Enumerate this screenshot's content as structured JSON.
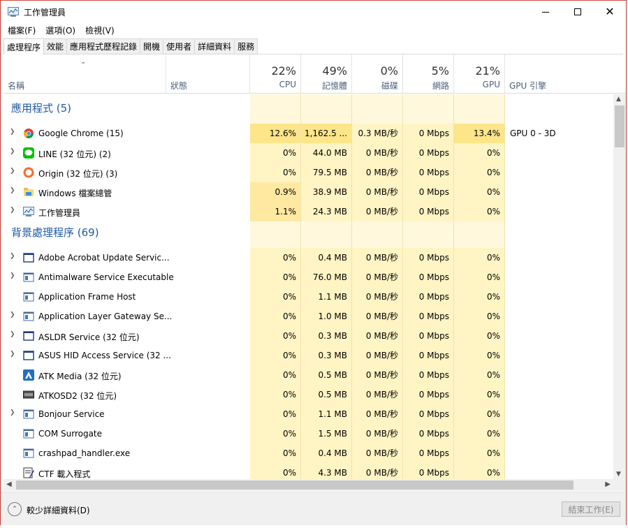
{
  "window": {
    "title": "工作管理員"
  },
  "menu": [
    "檔案(F)",
    "選項(O)",
    "檢視(V)"
  ],
  "tabs": [
    "處理程序",
    "效能",
    "應用程式歷程記錄",
    "開機",
    "使用者",
    "詳細資料",
    "服務"
  ],
  "header": {
    "name": "名稱",
    "status": "狀態",
    "cpu": {
      "pct": "22%",
      "label": "CPU"
    },
    "memory": {
      "pct": "49%",
      "label": "記憶體"
    },
    "disk": {
      "pct": "0%",
      "label": "磁碟"
    },
    "network": {
      "pct": "5%",
      "label": "網路"
    },
    "gpu": {
      "pct": "21%",
      "label": "GPU"
    },
    "gpu_engine": "GPU 引擎"
  },
  "groups": [
    {
      "title": "應用程式 (5)",
      "rows": [
        {
          "name": "Google Chrome (15)",
          "icon": "chrome-icon",
          "expand": true,
          "cpu": "12.6%",
          "mem": "1,162.5 ...",
          "disk": "0.3 MB/秒",
          "net": "0 Mbps",
          "gpu": "13.4%",
          "engine": "GPU 0 - 3D",
          "heat": [
            2,
            2,
            1,
            1,
            2
          ]
        },
        {
          "name": "LINE (32 位元) (2)",
          "icon": "line-icon",
          "expand": true,
          "cpu": "0%",
          "mem": "44.0 MB",
          "disk": "0 MB/秒",
          "net": "0 Mbps",
          "gpu": "0%",
          "engine": "",
          "heat": [
            1,
            1,
            1,
            1,
            1
          ]
        },
        {
          "name": "Origin (32 位元) (3)",
          "icon": "origin-icon",
          "expand": true,
          "cpu": "0%",
          "mem": "79.5 MB",
          "disk": "0 MB/秒",
          "net": "0 Mbps",
          "gpu": "0%",
          "engine": "",
          "heat": [
            1,
            1,
            1,
            1,
            1
          ]
        },
        {
          "name": "Windows 檔案總管",
          "icon": "folder-icon",
          "expand": true,
          "cpu": "0.9%",
          "mem": "38.9 MB",
          "disk": "0 MB/秒",
          "net": "0 Mbps",
          "gpu": "0%",
          "engine": "",
          "heat": [
            1.5,
            1,
            1,
            1,
            1
          ]
        },
        {
          "name": "工作管理員",
          "icon": "task-manager-icon",
          "expand": true,
          "cpu": "1.1%",
          "mem": "24.3 MB",
          "disk": "0 MB/秒",
          "net": "0 Mbps",
          "gpu": "0%",
          "engine": "",
          "heat": [
            1.5,
            1,
            1,
            1,
            1
          ]
        }
      ]
    },
    {
      "title": "背景處理程序 (69)",
      "rows": [
        {
          "name": "Adobe Acrobat Update Servic...",
          "icon": "window-icon",
          "expand": true,
          "cpu": "0%",
          "mem": "0.4 MB",
          "disk": "0 MB/秒",
          "net": "0 Mbps",
          "gpu": "0%",
          "engine": "",
          "heat": [
            1,
            1,
            1,
            1,
            1
          ]
        },
        {
          "name": "Antimalware Service Executable",
          "icon": "service-icon",
          "expand": true,
          "cpu": "0%",
          "mem": "76.0 MB",
          "disk": "0 MB/秒",
          "net": "0 Mbps",
          "gpu": "0%",
          "engine": "",
          "heat": [
            1,
            1,
            1,
            1,
            1
          ]
        },
        {
          "name": "Application Frame Host",
          "icon": "service-icon",
          "expand": false,
          "cpu": "0%",
          "mem": "1.1 MB",
          "disk": "0 MB/秒",
          "net": "0 Mbps",
          "gpu": "0%",
          "engine": "",
          "heat": [
            1,
            1,
            1,
            1,
            1
          ]
        },
        {
          "name": "Application Layer Gateway Se...",
          "icon": "service-icon",
          "expand": true,
          "cpu": "0%",
          "mem": "1.0 MB",
          "disk": "0 MB/秒",
          "net": "0 Mbps",
          "gpu": "0%",
          "engine": "",
          "heat": [
            1,
            1,
            1,
            1,
            1
          ]
        },
        {
          "name": "ASLDR Service (32 位元)",
          "icon": "window-icon",
          "expand": true,
          "cpu": "0%",
          "mem": "0.3 MB",
          "disk": "0 MB/秒",
          "net": "0 Mbps",
          "gpu": "0%",
          "engine": "",
          "heat": [
            1,
            1,
            1,
            1,
            1
          ]
        },
        {
          "name": "ASUS HID Access Service (32 ...",
          "icon": "window-icon",
          "expand": true,
          "cpu": "0%",
          "mem": "0.3 MB",
          "disk": "0 MB/秒",
          "net": "0 Mbps",
          "gpu": "0%",
          "engine": "",
          "heat": [
            1,
            1,
            1,
            1,
            1
          ]
        },
        {
          "name": "ATK Media (32 位元)",
          "icon": "atk-icon",
          "expand": false,
          "cpu": "0%",
          "mem": "0.5 MB",
          "disk": "0 MB/秒",
          "net": "0 Mbps",
          "gpu": "0%",
          "engine": "",
          "heat": [
            1,
            1,
            1,
            1,
            1
          ]
        },
        {
          "name": "ATKOSD2 (32 位元)",
          "icon": "osd-icon",
          "expand": false,
          "cpu": "0%",
          "mem": "0.5 MB",
          "disk": "0 MB/秒",
          "net": "0 Mbps",
          "gpu": "0%",
          "engine": "",
          "heat": [
            1,
            1,
            1,
            1,
            1
          ]
        },
        {
          "name": "Bonjour Service",
          "icon": "service-icon",
          "expand": true,
          "cpu": "0%",
          "mem": "1.1 MB",
          "disk": "0 MB/秒",
          "net": "0 Mbps",
          "gpu": "0%",
          "engine": "",
          "heat": [
            1,
            1,
            1,
            1,
            1
          ]
        },
        {
          "name": "COM Surrogate",
          "icon": "service-icon",
          "expand": false,
          "cpu": "0%",
          "mem": "1.5 MB",
          "disk": "0 MB/秒",
          "net": "0 Mbps",
          "gpu": "0%",
          "engine": "",
          "heat": [
            1,
            1,
            1,
            1,
            1
          ]
        },
        {
          "name": "crashpad_handler.exe",
          "icon": "service-icon",
          "expand": false,
          "cpu": "0%",
          "mem": "0.4 MB",
          "disk": "0 MB/秒",
          "net": "0 Mbps",
          "gpu": "0%",
          "engine": "",
          "heat": [
            1,
            1,
            1,
            1,
            1
          ]
        },
        {
          "name": "CTF 載入程式",
          "icon": "ctf-icon",
          "expand": false,
          "cpu": "0%",
          "mem": "4.3 MB",
          "disk": "0 MB/秒",
          "net": "0 Mbps",
          "gpu": "0%",
          "engine": "",
          "heat": [
            1,
            1,
            1,
            1,
            1
          ]
        }
      ]
    }
  ],
  "footer": {
    "fewer_details": "較少詳細資料(D)",
    "end_task": "結束工作(E)"
  },
  "colors": {
    "heat_bg": "#fff8dc",
    "heat_light": "#fff4c4",
    "heat_mid": "#ffe9a0",
    "heat_strong": "#fde58a",
    "group_title": "#1e5aa0",
    "accent_border": "#c0392b"
  }
}
